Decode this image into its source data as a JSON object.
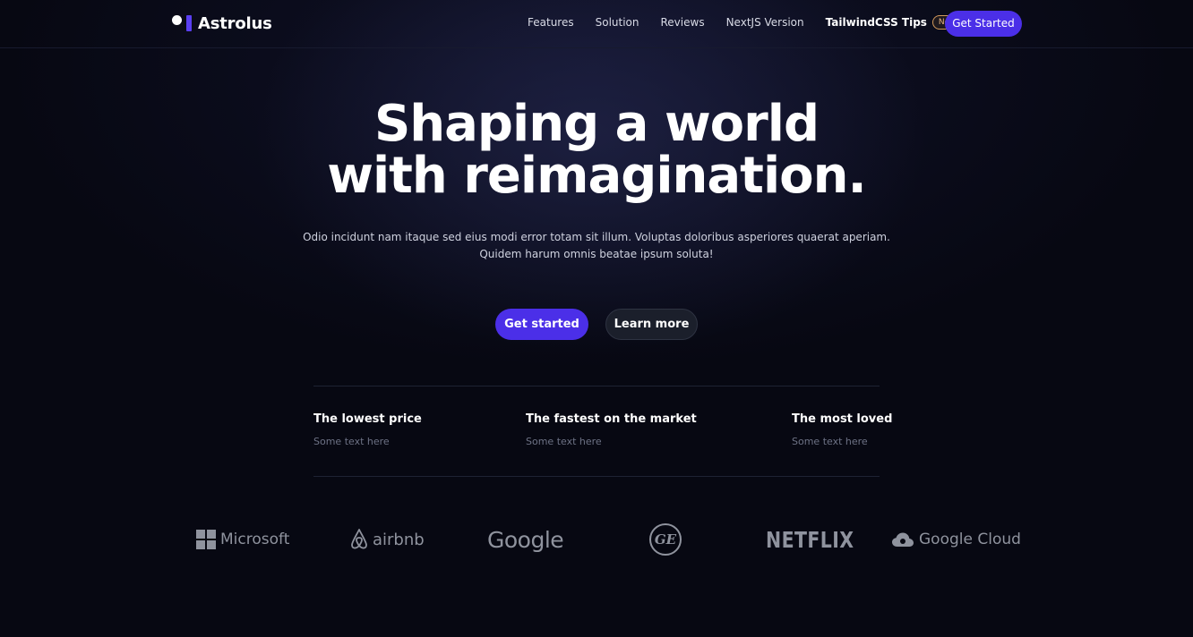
{
  "nav": {
    "brand": "Astrolus",
    "links": [
      "Features",
      "Solution",
      "Reviews",
      "NextJS Version",
      "TailwindCSS Tips"
    ],
    "badge": "New",
    "cta": "Get Started"
  },
  "hero": {
    "title_line1": "Shaping a world",
    "title_line2": "with reimagination.",
    "subtitle_line1": "Odio incidunt nam itaque sed eius modi error totam sit illum. Voluptas doloribus asperiores quaerat aperiam.",
    "subtitle_line2": "Quidem harum omnis beatae ipsum soluta!",
    "primary_cta": "Get started",
    "secondary_cta": "Learn more"
  },
  "features": [
    {
      "title": "The lowest price",
      "text": "Some text here"
    },
    {
      "title": "The fastest on the market",
      "text": "Some text here"
    },
    {
      "title": "The most loved",
      "text": "Some text here"
    }
  ],
  "logos": {
    "microsoft": "Microsoft",
    "airbnb": "airbnb",
    "google": "Google",
    "ge": "GE",
    "netflix": "NETFLIX",
    "google_cloud": "Google Cloud"
  },
  "colors": {
    "accent": "#4b2fe8",
    "background": "#070812",
    "badge": "#e8b47e"
  }
}
